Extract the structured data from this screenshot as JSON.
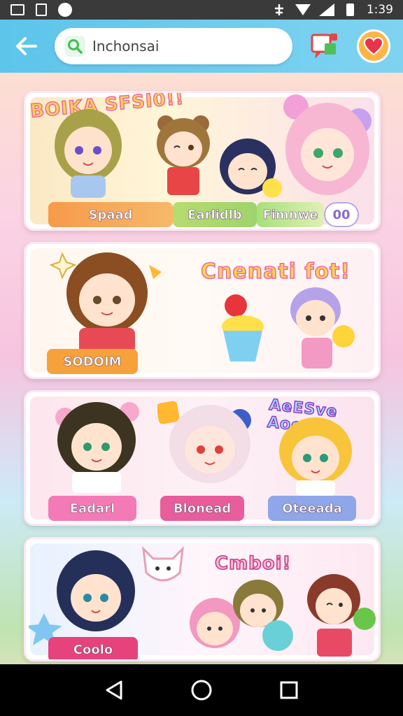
{
  "status_bar": {
    "time": "1:39",
    "icons": [
      "gallery-icon",
      "save-icon",
      "app-icon",
      "alarm-icon",
      "wifi-icon",
      "signal-icon",
      "battery-icon"
    ]
  },
  "header": {
    "back_icon": "arrow-left-icon",
    "search_text": "Inchonsai",
    "search_icon": "search-icon",
    "chat_icon": "chat-stickers-icon",
    "favorite_icon": "heart-icon",
    "colors": {
      "bar": "#5cc5ea",
      "heart_bg": "#ffb545"
    }
  },
  "cards": [
    {
      "title": "BOIKA SFSI0!!",
      "labels": [
        "Spaad",
        "Earlidlb",
        "Fimnwe",
        "00"
      ],
      "label_colors": [
        "#f7a24a",
        "#9fd36c",
        "#a7e07a",
        "#ffffff"
      ]
    },
    {
      "title": "Cnenati fot!",
      "labels": [
        "SODOIM"
      ],
      "label_colors": [
        "#f6a13a"
      ]
    },
    {
      "title": "AeESve Aoes",
      "labels": [
        "Eadarl",
        "Blonead",
        "Oteeada"
      ],
      "label_colors": [
        "#f47ab6",
        "#e85d9c",
        "#8fa6e8"
      ]
    },
    {
      "title": "Cmboi!",
      "labels": [
        "Coolo"
      ],
      "label_colors": [
        "#e6437d"
      ]
    }
  ],
  "nav": {
    "icons": [
      "back-triangle-icon",
      "home-circle-icon",
      "recents-square-icon"
    ]
  }
}
